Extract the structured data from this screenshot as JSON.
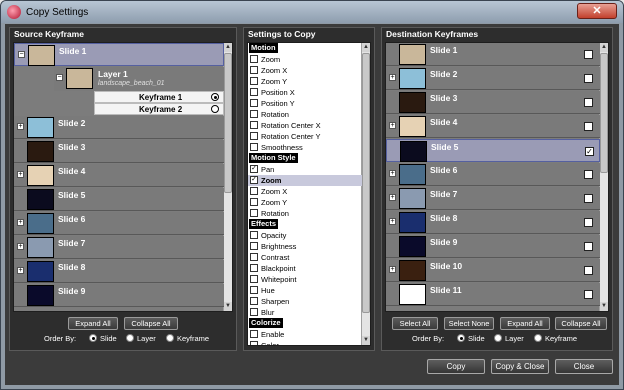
{
  "window": {
    "title": "Copy Settings",
    "close_glyph": "✕"
  },
  "source": {
    "title": "Source Keyframe",
    "slides": [
      {
        "label": "Slide 1",
        "thumb": "#c9b79a",
        "expander": "−",
        "selected": true
      },
      {
        "label": "Slide 2",
        "thumb": "#8dbfd8",
        "expander": "+"
      },
      {
        "label": "Slide 3",
        "thumb": "#2a1a10",
        "expander": ""
      },
      {
        "label": "Slide 4",
        "thumb": "#e6d2b4",
        "expander": "+"
      },
      {
        "label": "Slide 5",
        "thumb": "#0b0b1e",
        "expander": ""
      },
      {
        "label": "Slide 6",
        "thumb": "#4a6d8a",
        "expander": "+"
      },
      {
        "label": "Slide 7",
        "thumb": "#8a9ab0",
        "expander": "+"
      },
      {
        "label": "Slide 8",
        "thumb": "#1a2e6e",
        "expander": "+"
      },
      {
        "label": "Slide 9",
        "thumb": "#0a0a2a",
        "expander": ""
      }
    ],
    "layer": {
      "label": "Layer 1",
      "sublabel": "landscape_beach_01",
      "expander": "−"
    },
    "keyframes": [
      {
        "label": "Keyframe 1",
        "selected": true
      },
      {
        "label": "Keyframe 2",
        "selected": false
      }
    ],
    "buttons": {
      "expand_all": "Expand All",
      "collapse_all": "Collapse All"
    },
    "order_by": {
      "label": "Order By:",
      "options": [
        "Slide",
        "Layer",
        "Keyframe"
      ],
      "selected": "Slide"
    }
  },
  "settings": {
    "title": "Settings to Copy",
    "items": [
      {
        "type": "head",
        "label": "Motion"
      },
      {
        "label": "Zoom",
        "checked": false
      },
      {
        "label": "Zoom X",
        "checked": false
      },
      {
        "label": "Zoom Y",
        "checked": false
      },
      {
        "label": "Position X",
        "checked": false
      },
      {
        "label": "Position Y",
        "checked": false
      },
      {
        "label": "Rotation",
        "checked": false
      },
      {
        "label": "Rotation Center X",
        "checked": false
      },
      {
        "label": "Rotation Center Y",
        "checked": false
      },
      {
        "label": "Smoothness",
        "checked": false
      },
      {
        "type": "head",
        "label": "Motion Style"
      },
      {
        "label": "Pan",
        "checked": true
      },
      {
        "label": "Zoom",
        "checked": true,
        "highlight": true
      },
      {
        "label": "Zoom X",
        "checked": false
      },
      {
        "label": "Zoom Y",
        "checked": false
      },
      {
        "label": "Rotation",
        "checked": false
      },
      {
        "type": "head",
        "label": "Effects"
      },
      {
        "label": "Opacity",
        "checked": false
      },
      {
        "label": "Brightness",
        "checked": false
      },
      {
        "label": "Contrast",
        "checked": false
      },
      {
        "label": "Blackpoint",
        "checked": false
      },
      {
        "label": "Whitepoint",
        "checked": false
      },
      {
        "label": "Hue",
        "checked": false
      },
      {
        "label": "Sharpen",
        "checked": false
      },
      {
        "label": "Blur",
        "checked": false
      },
      {
        "type": "head",
        "label": "Colorize"
      },
      {
        "label": "Enable",
        "checked": false
      },
      {
        "label": "Color",
        "checked": false
      }
    ]
  },
  "destination": {
    "title": "Destination Keyframes",
    "slides": [
      {
        "label": "Slide 1",
        "thumb": "#c9b79a",
        "expander": "",
        "checked": false
      },
      {
        "label": "Slide 2",
        "thumb": "#8dbfd8",
        "expander": "+",
        "checked": false
      },
      {
        "label": "Slide 3",
        "thumb": "#2a1a10",
        "expander": "",
        "checked": false
      },
      {
        "label": "Slide 4",
        "thumb": "#e6d2b4",
        "expander": "+",
        "checked": false
      },
      {
        "label": "Slide 5",
        "thumb": "#0b0b1e",
        "expander": "",
        "checked": true,
        "selected": true
      },
      {
        "label": "Slide 6",
        "thumb": "#4a6d8a",
        "expander": "+",
        "checked": false
      },
      {
        "label": "Slide 7",
        "thumb": "#8a9ab0",
        "expander": "+",
        "checked": false
      },
      {
        "label": "Slide 8",
        "thumb": "#1a2e6e",
        "expander": "+",
        "checked": false
      },
      {
        "label": "Slide 9",
        "thumb": "#0a0a2a",
        "expander": "",
        "checked": false
      },
      {
        "label": "Slide 10",
        "thumb": "#3a2010",
        "expander": "+",
        "checked": false
      },
      {
        "label": "Slide 11",
        "thumb": "#ffffff",
        "expander": "",
        "checked": false
      }
    ],
    "buttons": {
      "select_all": "Select All",
      "select_none": "Select None",
      "expand_all": "Expand All",
      "collapse_all": "Collapse All"
    },
    "order_by": {
      "label": "Order By:",
      "options": [
        "Slide",
        "Layer",
        "Keyframe"
      ],
      "selected": "Slide"
    }
  },
  "footer": {
    "copy": "Copy",
    "copy_close": "Copy & Close",
    "close": "Close"
  },
  "scroll": {
    "up": "▲",
    "down": "▼"
  }
}
